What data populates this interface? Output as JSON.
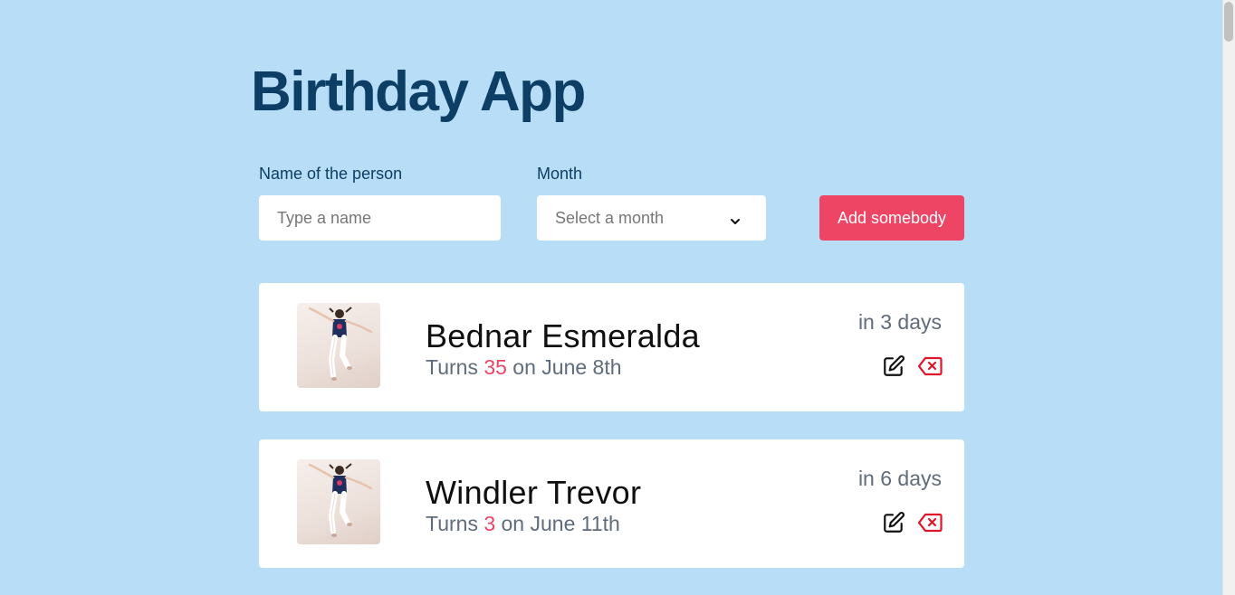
{
  "app": {
    "title": "Birthday App"
  },
  "form": {
    "name_label": "Name of the person",
    "name_placeholder": "Type a name",
    "month_label": "Month",
    "month_selected": "Select a month",
    "add_button": "Add somebody"
  },
  "people": [
    {
      "name": "Bednar Esmeralda",
      "turns_prefix": "Turns ",
      "age": "35",
      "date_text": " on June 8th",
      "days": "in 3 days"
    },
    {
      "name": "Windler Trevor",
      "turns_prefix": "Turns ",
      "age": "3",
      "date_text": " on June 11th",
      "days": "in 6 days"
    }
  ],
  "icons": {
    "edit": "edit-icon",
    "delete": "delete-backspace-icon",
    "chevron": "chevron-down-icon"
  },
  "colors": {
    "background": "#b8ddf6",
    "title": "#0c3e66",
    "accent": "#ef4565",
    "subtext": "#5f6c7b",
    "delete_icon": "#e0152a"
  }
}
